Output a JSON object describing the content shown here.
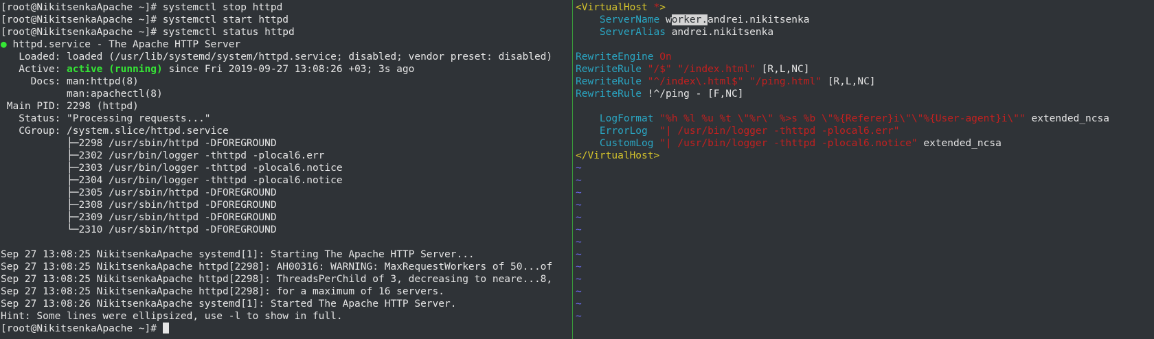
{
  "terminal": {
    "prompt": "[root@NikitsenkaApache ~]# ",
    "commands": [
      "systemctl stop httpd",
      "systemctl start httpd",
      "systemctl status httpd"
    ],
    "status_dot": "●",
    "unit_title": " httpd.service - The Apache HTTP Server",
    "loaded": "   Loaded: loaded (/usr/lib/systemd/system/httpd.service; disabled; vendor preset: disabled)",
    "active_prefix": "   Active: ",
    "active_state": "active (running)",
    "active_suffix": " since Fri 2019-09-27 13:08:26 +03; 3s ago",
    "docs_1": "     Docs: man:httpd(8)",
    "docs_2": "           man:apachectl(8)",
    "main_pid": " Main PID: 2298 (httpd)",
    "status": "   Status: \"Processing requests...\"",
    "cgroup": "   CGroup: /system.slice/httpd.service",
    "processes": [
      "           ├─2298 /usr/sbin/httpd -DFOREGROUND",
      "           ├─2302 /usr/bin/logger -thttpd -plocal6.err",
      "           ├─2303 /usr/bin/logger -thttpd -plocal6.notice",
      "           ├─2304 /usr/bin/logger -thttpd -plocal6.notice",
      "           ├─2305 /usr/sbin/httpd -DFOREGROUND",
      "           ├─2308 /usr/sbin/httpd -DFOREGROUND",
      "           ├─2309 /usr/sbin/httpd -DFOREGROUND",
      "           └─2310 /usr/sbin/httpd -DFOREGROUND"
    ],
    "log_lines": [
      "Sep 27 13:08:25 NikitsenkaApache systemd[1]: Starting The Apache HTTP Server...",
      "Sep 27 13:08:25 NikitsenkaApache httpd[2298]: AH00316: WARNING: MaxRequestWorkers of 50...of",
      "Sep 27 13:08:25 NikitsenkaApache httpd[2298]: ThreadsPerChild of 3, decreasing to neare...8,",
      "Sep 27 13:08:25 NikitsenkaApache httpd[2298]: for a maximum of 16 servers.",
      "Sep 27 13:08:26 NikitsenkaApache systemd[1]: Started The Apache HTTP Server."
    ],
    "hint": "Hint: Some lines were ellipsized, use -l to show in full."
  },
  "editor": {
    "vhost_open": "<VirtualHost ",
    "vhost_star": "*",
    "vhost_close_bracket": ">",
    "server_name_kw": "ServerName",
    "server_name_pre": "w",
    "server_name_hl": "orker.",
    "server_name_post": "andrei.nikitsenka",
    "server_alias_kw": "ServerAlias",
    "server_alias_val": "andrei.nikitsenka",
    "rewrite_engine_kw": "RewriteEngine",
    "rewrite_engine_val": "On",
    "rewrite_rule_kw": "RewriteRule",
    "rule1_a": "\"/$\"",
    "rule1_b": "\"/index.html\"",
    "rule1_flags": "[R,L,NC]",
    "rule2_a": "\"^/index\\.html$\"",
    "rule2_b": "\"/ping.html\"",
    "rule2_flags": "[R,L,NC]",
    "rule3_rest": "!^/ping - [F,NC]",
    "log_format_kw": "LogFormat",
    "log_format_str": "\"%h %l %u %t \\\"%r\\\" %>s %b \\\"%{Referer}i\\\"\\\"%{User-agent}i\\\"\"",
    "log_format_name": "extended_ncsa",
    "error_log_kw": "ErrorLog",
    "error_log_str": "\"| /usr/bin/logger -thttpd -plocal6.err\"",
    "custom_log_kw": "CustomLog",
    "custom_log_str": "\"| /usr/bin/logger -thttpd -plocal6.notice\"",
    "custom_log_name": "extended_ncsa",
    "vhost_end": "</VirtualHost>",
    "tilde": "~"
  },
  "colors": {
    "background": "#2f3337",
    "foreground": "#e6e6e6",
    "green": "#35e635",
    "keyword": "#2aa7c4",
    "tag": "#d5c42c",
    "string": "#c4201f",
    "tilde": "#6c6cf0",
    "divider": "#3a9c3a"
  }
}
